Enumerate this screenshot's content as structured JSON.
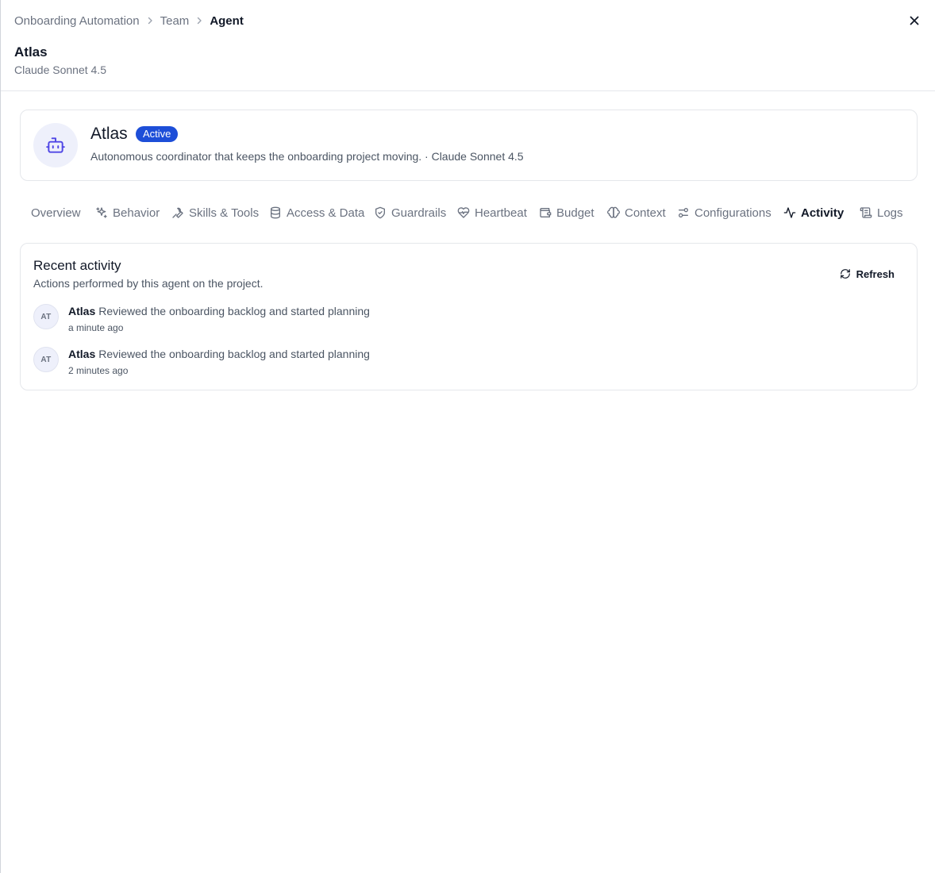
{
  "breadcrumb": {
    "items": [
      "Onboarding Automation",
      "Team",
      "Agent"
    ]
  },
  "header": {
    "title": "Atlas",
    "subtitle": "Claude Sonnet 4.5"
  },
  "agent": {
    "name": "Atlas",
    "status": "Active",
    "description": "Autonomous coordinator that keeps the onboarding project moving. · Claude Sonnet 4.5",
    "icon": "robot-icon"
  },
  "tabs": [
    {
      "label": "Overview",
      "icon": "none"
    },
    {
      "label": "Behavior",
      "icon": "sparkles-icon"
    },
    {
      "label": "Skills & Tools",
      "icon": "wrench-icon"
    },
    {
      "label": "Access & Data",
      "icon": "database-icon"
    },
    {
      "label": "Guardrails",
      "icon": "shield-icon"
    },
    {
      "label": "Heartbeat",
      "icon": "heart-pulse-icon"
    },
    {
      "label": "Budget",
      "icon": "wallet-icon"
    },
    {
      "label": "Context",
      "icon": "brain-icon"
    },
    {
      "label": "Configurations",
      "icon": "settings-sliders-icon"
    },
    {
      "label": "Activity",
      "icon": "activity-icon",
      "active": true
    },
    {
      "label": "Logs",
      "icon": "scroll-icon"
    }
  ],
  "activity": {
    "title": "Recent activity",
    "subtitle": "Actions performed by this agent on the project.",
    "refresh_label": "Refresh",
    "items": [
      {
        "initials": "AT",
        "actor": "Atlas",
        "text": "Reviewed the onboarding backlog and started planning",
        "time": "a minute ago"
      },
      {
        "initials": "AT",
        "actor": "Atlas",
        "text": "Reviewed the onboarding backlog and started planning",
        "time": "2 minutes ago"
      }
    ]
  },
  "colors": {
    "accent": "#1d4ed8",
    "avatar_bg": "#eef0fb",
    "border": "#e5e7eb",
    "muted_text": "#6b7280"
  }
}
